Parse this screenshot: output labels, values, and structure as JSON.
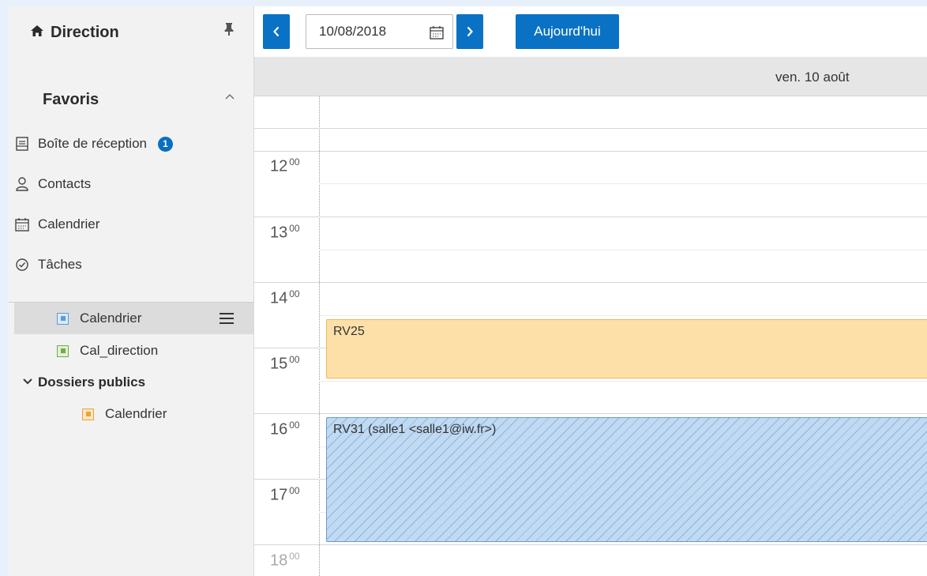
{
  "sidebar": {
    "title": "Direction",
    "favorites_title": "Favoris",
    "nav": [
      {
        "label": "Boîte de réception",
        "icon": "inbox-icon",
        "badge": "1"
      },
      {
        "label": "Contacts",
        "icon": "person-icon"
      },
      {
        "label": "Calendrier",
        "icon": "calendar-icon"
      },
      {
        "label": "Tâches",
        "icon": "check-circle-icon"
      }
    ],
    "calendars": [
      {
        "label": "Calendrier",
        "color": "#5b9bd5",
        "selected": true
      },
      {
        "label": "Cal_direction",
        "color": "#70ad47"
      }
    ],
    "public_folders": {
      "title": "Dossiers publics",
      "items": [
        {
          "label": "Calendrier",
          "color": "#e8a53a"
        }
      ]
    }
  },
  "toolbar": {
    "date_value": "10/08/2018",
    "today_label": "Aujourd'hui"
  },
  "day_header": "ven. 10 août",
  "hours": [
    "12",
    "13",
    "14",
    "15",
    "16",
    "17",
    "18"
  ],
  "hour_minutes": "00",
  "events": [
    {
      "title": "RV25",
      "start": "14:30",
      "end": "15:30",
      "color": "#fde0a7"
    },
    {
      "title": "RV31 (salle1 <salle1@iw.fr>)",
      "start": "16:00",
      "end": "18:00",
      "color": "#bfdaf2"
    }
  ]
}
